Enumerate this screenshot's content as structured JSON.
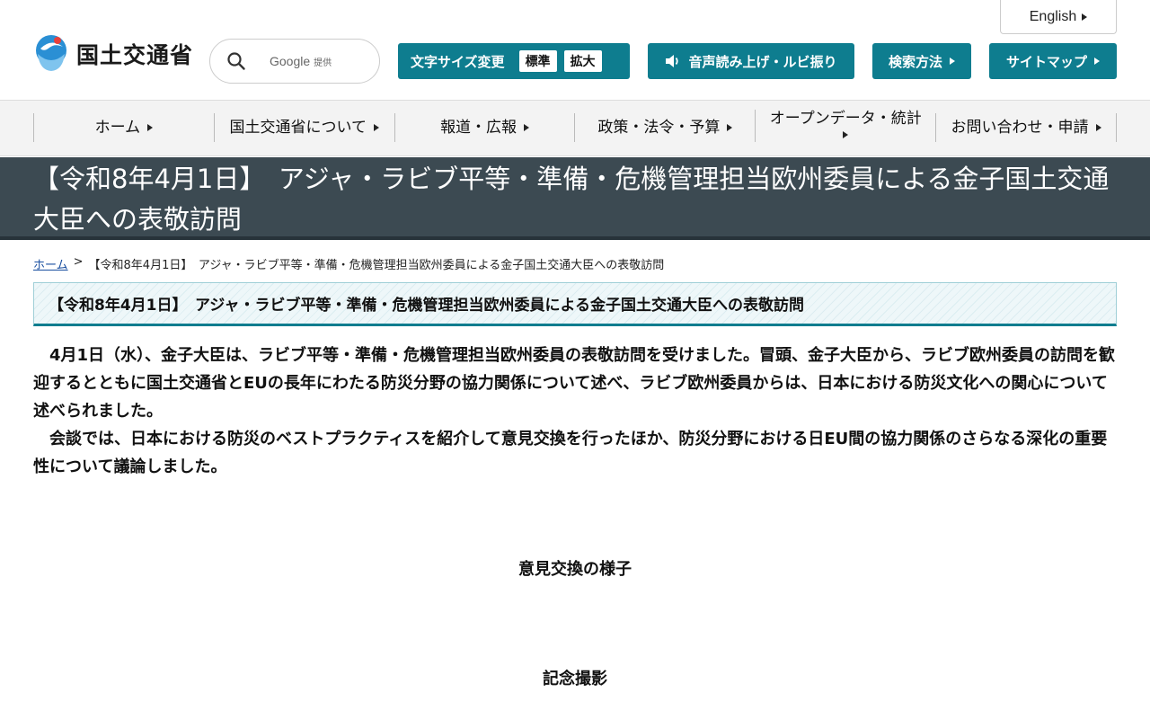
{
  "header": {
    "english_label": "English",
    "logo_text": "国土交通省",
    "search": {
      "provider": "Google",
      "provider_suffix": "提供"
    },
    "font_size": {
      "label": "文字サイズ変更",
      "standard": "標準",
      "large": "拡大"
    },
    "read_aloud_label": "音声読み上げ・ルビ振り",
    "search_method_label": "検索方法",
    "sitemap_label": "サイトマップ"
  },
  "nav": {
    "items": [
      {
        "label": "ホーム"
      },
      {
        "label": "国土交通省について"
      },
      {
        "label": "報道・広報"
      },
      {
        "label": "政策・法令・予算"
      },
      {
        "label": "オープンデータ・統計"
      },
      {
        "label": "お問い合わせ・申請"
      }
    ]
  },
  "page": {
    "title": "【令和8年4月1日】　アジャ・ラビブ平等・準備・危機管理担当欧州委員による金子国土交通大臣への表敬訪問",
    "breadcrumb": {
      "home": "ホーム",
      "separator": ">",
      "current": "【令和8年4月1日】　アジャ・ラビブ平等・準備・危機管理担当欧州委員による金子国土交通大臣への表敬訪問"
    },
    "section_heading": "【令和8年4月1日】　アジャ・ラビブ平等・準備・危機管理担当欧州委員による金子国土交通大臣への表敬訪問",
    "paragraph1": "4月1日（水）、金子大臣は、ラビブ平等・準備・危機管理担当欧州委員の表敬訪問を受けました。冒頭、金子大臣から、ラビブ欧州委員の訪問を歓迎するとともに国土交通省とEUの長年にわたる防災分野の協力関係について述べ、ラビブ欧州委員からは、日本における防災文化への関心について述べられました。",
    "paragraph2": "会談では、日本における防災のベストプラクティスを紹介して意見交換を行ったほか、防災分野における日EU間の協力関係のさらなる深化の重要性について議論しました。",
    "caption1": "意見交換の様子",
    "caption2": "記念撮影"
  },
  "colors": {
    "accent": "#0e7d8f",
    "title_band": "#3c4a52",
    "link": "#1a4fa0"
  }
}
